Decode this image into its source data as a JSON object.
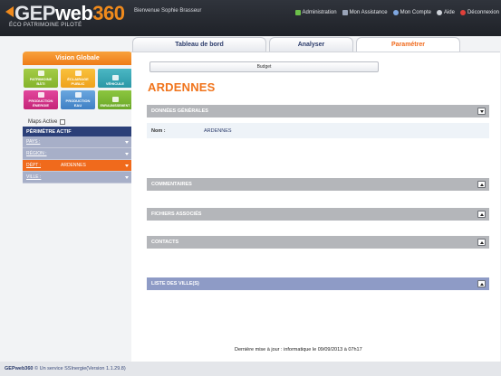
{
  "header": {
    "logo_text_1": "GEP",
    "logo_text_2": "web",
    "logo_text_3": "360",
    "tagline": "ÉCO PATRIMOINE PILOTÉ",
    "welcome": "Bienvenue Sophie Brasseur",
    "nav": [
      {
        "label": "Administration",
        "icon": "admin-icon",
        "color": "#6cc04a"
      },
      {
        "label": "Mon Assistance",
        "icon": "assistance-icon",
        "color": "#9aa4b8"
      },
      {
        "label": "Mon Compte",
        "icon": "account-icon",
        "color": "#7fa7e0"
      },
      {
        "label": "Aide",
        "icon": "help-icon",
        "color": "#cfd3da"
      },
      {
        "label": "Déconnexion",
        "icon": "logout-icon",
        "color": "#e0403a"
      }
    ]
  },
  "tabs": [
    {
      "label": "Tableau de bord"
    },
    {
      "label": "Analyser"
    },
    {
      "label": "Paramétrer",
      "active": true
    }
  ],
  "sidebar": {
    "vision_label": "Vision Globale",
    "tiles": [
      {
        "label": "PATRIMOINE\nBÂTI",
        "icon": "building-icon"
      },
      {
        "label": "ÉCLAIRAGE\nPUBLIC",
        "icon": "lamp-icon"
      },
      {
        "label": "VÉHICULE",
        "icon": "car-icon"
      },
      {
        "label": "PRODUCTION\nÉNERGIE",
        "icon": "energy-icon"
      },
      {
        "label": "PRODUCTION\nEAU",
        "icon": "water-icon"
      },
      {
        "label": "ENRAUNISSEMENT",
        "icon": "recycle-icon"
      }
    ],
    "maps_active_label": "Maps Active",
    "perimetre_label": "PÉRIMÈTRE ACTIF",
    "filters": [
      {
        "label": "PAYS :",
        "value": ""
      },
      {
        "label": "RÉGION :",
        "value": ""
      },
      {
        "label": "DÉPT :",
        "value": "ARDENNES",
        "active": true
      },
      {
        "label": "VILLE :",
        "value": ""
      }
    ]
  },
  "main": {
    "budget_label": "Budget",
    "title": "ARDENNES",
    "sections": {
      "general": "DONNÉES GÉNÉRALES",
      "comments": "COMMENTAIRES",
      "files": "FICHIERS ASSOCIÉS",
      "contacts": "CONTACTS",
      "cities": "LISTE DES VILLE(S)"
    },
    "nom_label": "Nom :",
    "nom_value": "ARDENNES",
    "last_update": "Dernière mise à jour : informatique le 09/09/2013 à 07h17"
  },
  "footer": {
    "brand": "GEPweb360",
    "text": "© Un service SSInergie(Version 1.1.29.8)"
  },
  "colors": {
    "accent": "#f06a1c",
    "nav_dark": "#2b3f78",
    "section_grey": "#b4b6ba",
    "section_blue": "#8e9bc6"
  }
}
